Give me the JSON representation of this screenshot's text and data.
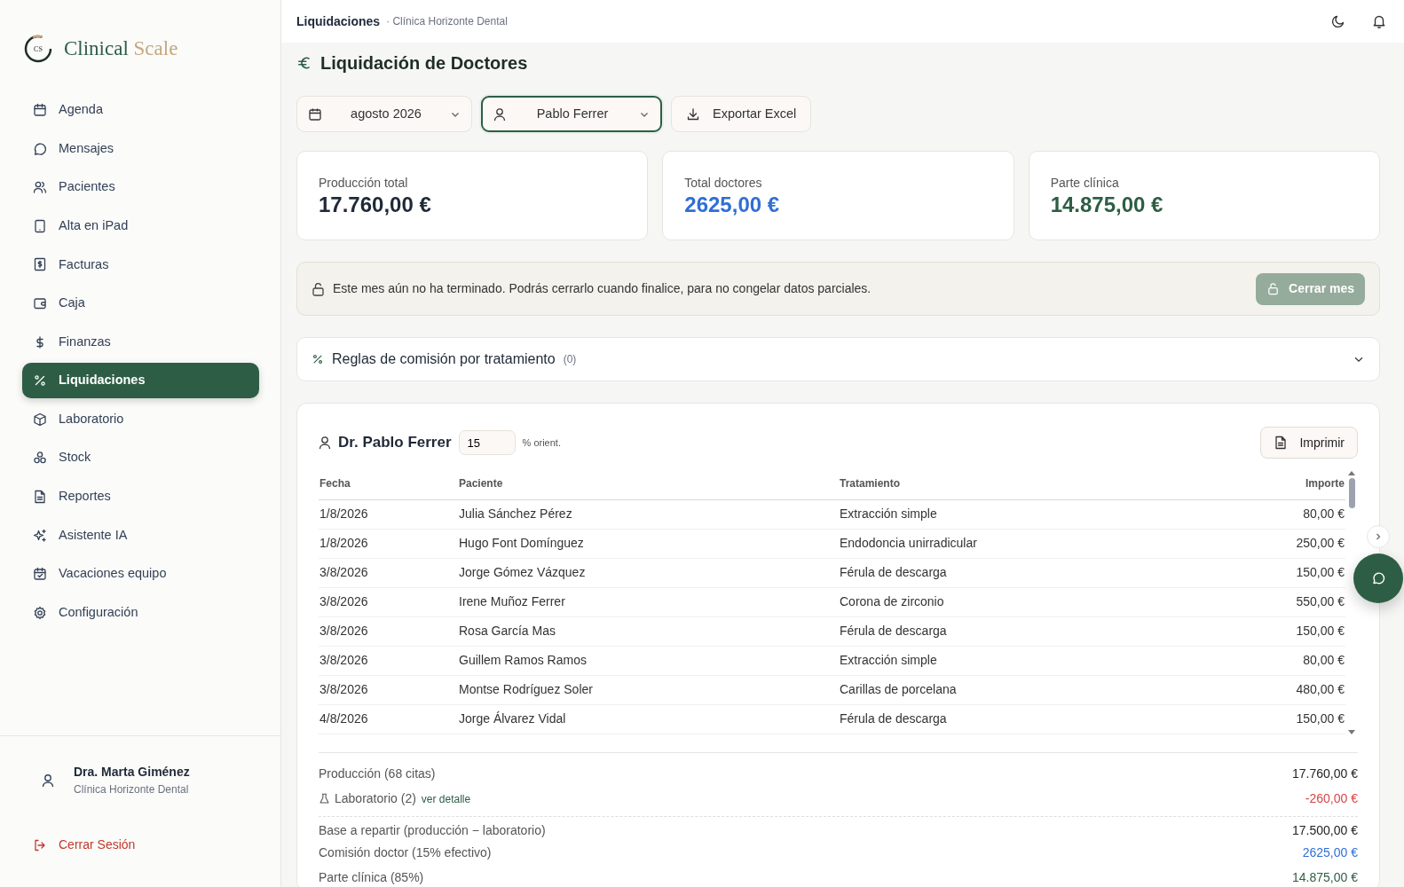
{
  "brand": {
    "word1": "Clinical",
    "word2": "Scale",
    "mark": "CS"
  },
  "sidebar": {
    "items": [
      {
        "label": "Agenda",
        "selected": false
      },
      {
        "label": "Mensajes",
        "selected": false
      },
      {
        "label": "Pacientes",
        "selected": false
      },
      {
        "label": "Alta en iPad",
        "selected": false
      },
      {
        "label": "Facturas",
        "selected": false
      },
      {
        "label": "Caja",
        "selected": false
      },
      {
        "label": "Finanzas",
        "selected": false
      },
      {
        "label": "Liquidaciones",
        "selected": true
      },
      {
        "label": "Laboratorio",
        "selected": false
      },
      {
        "label": "Stock",
        "selected": false
      },
      {
        "label": "Reportes",
        "selected": false
      },
      {
        "label": "Asistente IA",
        "selected": false
      },
      {
        "label": "Vacaciones equipo",
        "selected": false
      },
      {
        "label": "Configuración",
        "selected": false
      }
    ],
    "user": {
      "name": "Dra. Marta Giménez",
      "clinic": "Clínica Horizonte Dental"
    },
    "logout": "Cerrar Sesión"
  },
  "topbar": {
    "title": "Liquidaciones",
    "subtitle": "· Clínica Horizonte Dental"
  },
  "page_title": "Liquidación de Doctores",
  "filters": {
    "month": "agosto 2026",
    "doctor": "Pablo Ferrer",
    "export": "Exportar Excel"
  },
  "stats": [
    {
      "label": "Producción total",
      "value": "17.760,00 €",
      "kind": "neutral"
    },
    {
      "label": "Total doctores",
      "value": "2625,00 €",
      "kind": "doctor"
    },
    {
      "label": "Parte clínica",
      "value": "14.875,00 €",
      "kind": "clinic"
    }
  ],
  "notice": {
    "text": "Este mes aún no ha terminado. Podrás cerrarlo cuando finalice, para no congelar datos parciales.",
    "button": "Cerrar mes",
    "disabled": true
  },
  "rules": {
    "title": "Reglas de comisión por tratamiento",
    "count": "(0)",
    "expanded": false
  },
  "doctor": {
    "name": "Dr. Pablo Ferrer",
    "percent": "15",
    "percent_label": "% orient.",
    "print": "Imprimir",
    "table": {
      "columns": [
        "Fecha",
        "Paciente",
        "Tratamiento",
        "Importe"
      ],
      "rows": [
        [
          "1/8/2026",
          "Julia Sánchez Pérez",
          "Extracción simple",
          "80,00 €"
        ],
        [
          "1/8/2026",
          "Hugo Font Domínguez",
          "Endodoncia unirradicular",
          "250,00 €"
        ],
        [
          "3/8/2026",
          "Jorge Gómez Vázquez",
          "Férula de descarga",
          "150,00 €"
        ],
        [
          "3/8/2026",
          "Irene Muñoz Ferrer",
          "Corona de zirconio",
          "550,00 €"
        ],
        [
          "3/8/2026",
          "Rosa García Mas",
          "Férula de descarga",
          "150,00 €"
        ],
        [
          "3/8/2026",
          "Guillem Ramos Ramos",
          "Extracción simple",
          "80,00 €"
        ],
        [
          "3/8/2026",
          "Montse Rodríguez Soler",
          "Carillas de porcelana",
          "480,00 €"
        ],
        [
          "4/8/2026",
          "Jorge Álvarez Vidal",
          "Férula de descarga",
          "150,00 €"
        ]
      ]
    },
    "summary": [
      {
        "kind": "total",
        "label": "Producción (68 citas)",
        "value": "17.760,00 €"
      },
      {
        "kind": "lab",
        "label": "Laboratorio (2)",
        "link": "ver detalle",
        "value": "-260,00 €"
      },
      {
        "kind": "base",
        "label": "Base a repartir (producción − laboratorio)",
        "value": "17.500,00 €"
      },
      {
        "kind": "doctor",
        "label": "Comisión doctor (15% efectivo)",
        "value": "2625,00 €"
      },
      {
        "kind": "clinic",
        "label": "Parte clínica (85%)",
        "value": "14.875,00 €"
      }
    ]
  }
}
